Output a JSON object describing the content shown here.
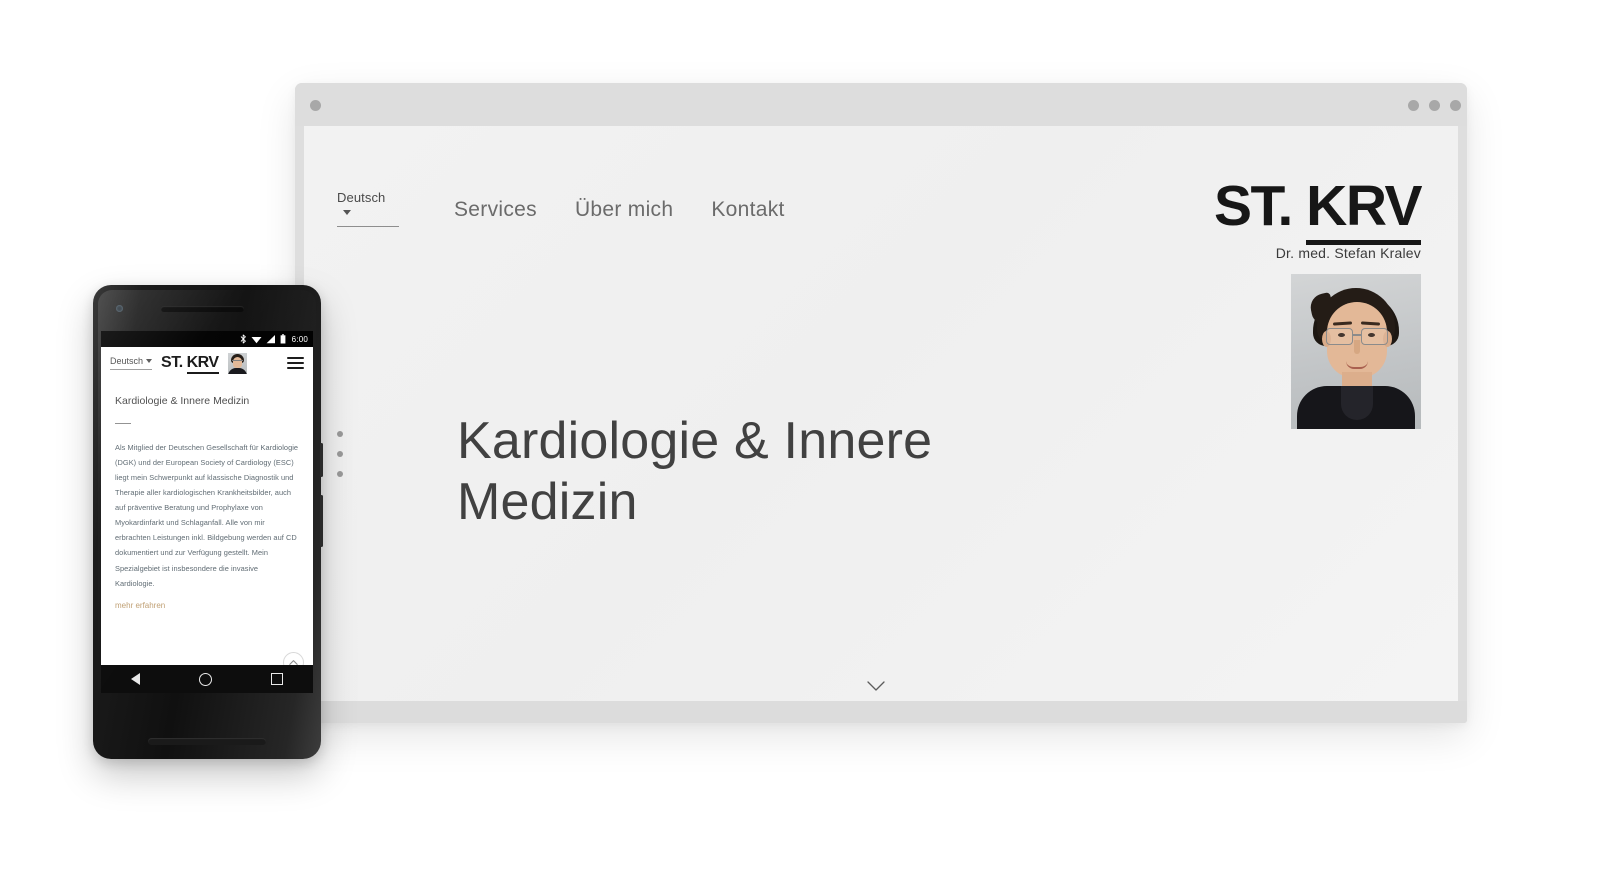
{
  "browser": {
    "window_dots": [
      "dot-left",
      "dot-right-1",
      "dot-right-2",
      "dot-right-3"
    ]
  },
  "desktop": {
    "language_selector": "Deutsch",
    "nav": [
      {
        "label": "Services"
      },
      {
        "label": "Über mich"
      },
      {
        "label": "Kontakt"
      }
    ],
    "brand": {
      "logo_first": "ST.",
      "logo_second": "KRV",
      "subtitle": "Dr. med. Stefan Kralev"
    },
    "hero": {
      "title": "Kardiologie & Innere Medizin"
    },
    "scroll_hint_icon": "chevron-down-icon",
    "section_dots_count": 3
  },
  "phone": {
    "status_bar": {
      "bluetooth_icon": "bluetooth-icon",
      "wifi_icon": "wifi-icon",
      "signal_icon": "signal-icon",
      "battery_icon": "battery-icon",
      "time": "6:00"
    },
    "header": {
      "language_selector": "Deutsch",
      "logo_first": "ST.",
      "logo_second": "KRV",
      "avatar_icon": "avatar-portrait-icon",
      "menu_icon": "hamburger-menu-icon"
    },
    "content": {
      "title": "Kardiologie & Innere Medizin",
      "body": "Als Mitglied der Deutschen Gesellschaft für Kardiologie (DGK) und der European Society of Cardiology (ESC) liegt mein Schwerpunkt auf klassische Diagnostik und Therapie aller kardiologischen Krankheitsbilder, auch auf präventive Beratung und Prophylaxe von Myokardinfarkt und Schlaganfall. Alle von mir erbrachten Leistungen inkl. Bildgebung werden auf CD dokumentiert und zur Verfügung gestellt. Mein Spezialgebiet ist insbesondere die invasive Kardiologie.",
      "more_link": "mehr erfahren",
      "scroll_up_icon": "chevron-up-icon"
    },
    "navbar": {
      "back_icon": "back-triangle-icon",
      "home_icon": "home-circle-icon",
      "recents_icon": "recents-square-icon"
    }
  },
  "colors": {
    "accent_link": "#c0a074",
    "logo_black": "#171717",
    "page_bg": "#f2f2f2",
    "body_text": "#5f6b73"
  }
}
